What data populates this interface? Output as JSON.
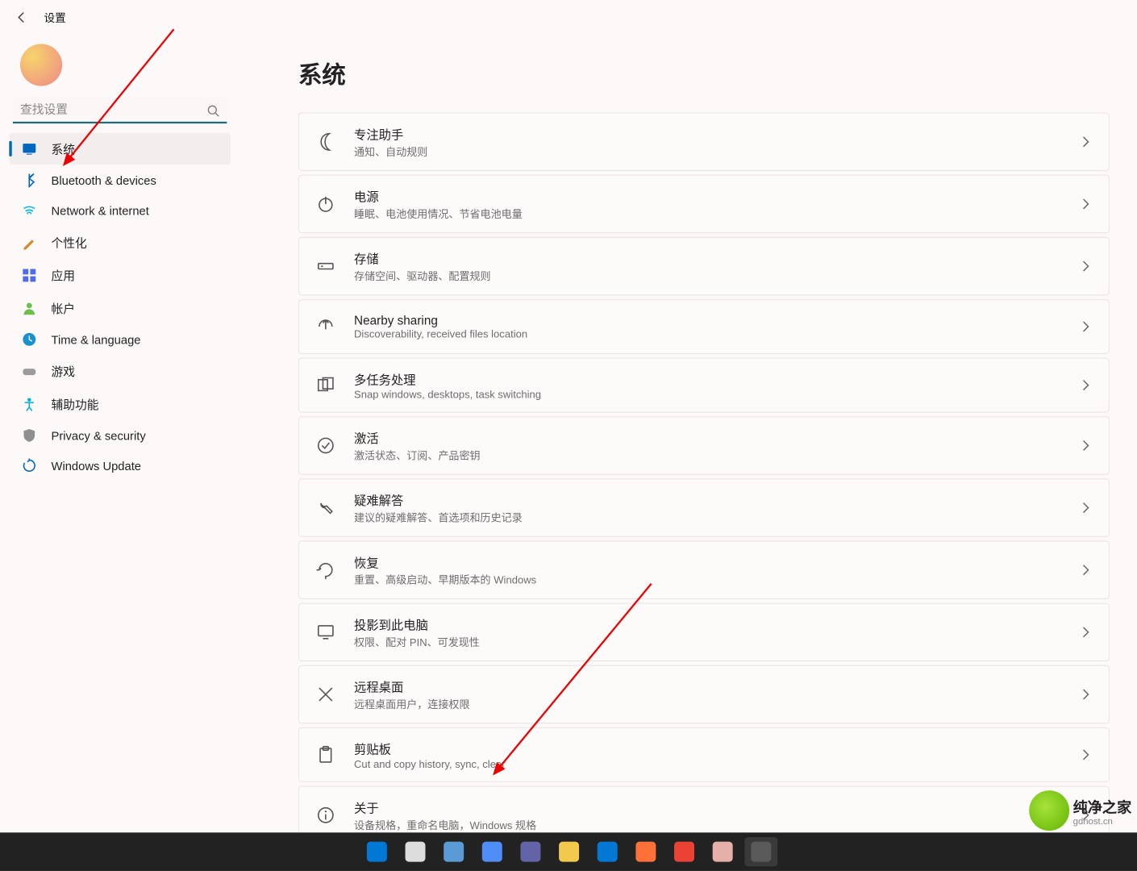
{
  "titlebar": {
    "app_name": "设置"
  },
  "search": {
    "placeholder": "查找设置"
  },
  "sidebar": {
    "items": [
      {
        "label": "系统",
        "icon": "system-icon",
        "color": "#0067c0",
        "active": true
      },
      {
        "label": "Bluetooth & devices",
        "icon": "bluetooth-icon",
        "color": "#0067c0"
      },
      {
        "label": "Network & internet",
        "icon": "wifi-icon",
        "color": "#00b7e0"
      },
      {
        "label": "个性化",
        "icon": "personalize-icon",
        "color": "#d38b2d"
      },
      {
        "label": "应用",
        "icon": "apps-icon",
        "color": "#4f6bed"
      },
      {
        "label": "帐户",
        "icon": "account-icon",
        "color": "#6ebe4a"
      },
      {
        "label": "Time & language",
        "icon": "time-icon",
        "color": "#1a91cf"
      },
      {
        "label": "游戏",
        "icon": "gaming-icon",
        "color": "#9b9b9b"
      },
      {
        "label": "辅助功能",
        "icon": "accessibility-icon",
        "color": "#00aee0"
      },
      {
        "label": "Privacy & security",
        "icon": "privacy-icon",
        "color": "#8f8f8f"
      },
      {
        "label": "Windows Update",
        "icon": "update-icon",
        "color": "#0067c0"
      }
    ]
  },
  "main": {
    "page_title": "系统",
    "cards": [
      {
        "title": "专注助手",
        "desc": "通知、自动规则",
        "icon": "moon-icon"
      },
      {
        "title": "电源",
        "desc": "睡眠、电池使用情况、节省电池电量",
        "icon": "power-icon"
      },
      {
        "title": "存储",
        "desc": "存储空间、驱动器、配置规则",
        "icon": "storage-icon"
      },
      {
        "title": "Nearby sharing",
        "desc": "Discoverability, received files location",
        "icon": "share-icon"
      },
      {
        "title": "多任务处理",
        "desc": "Snap windows, desktops, task switching",
        "icon": "multitask-icon"
      },
      {
        "title": "激活",
        "desc": "激活状态、订阅、产品密钥",
        "icon": "activate-icon"
      },
      {
        "title": "疑难解答",
        "desc": "建议的疑难解答、首选项和历史记录",
        "icon": "troubleshoot-icon"
      },
      {
        "title": "恢复",
        "desc": "重置、高级启动、早期版本的 Windows",
        "icon": "recovery-icon"
      },
      {
        "title": "投影到此电脑",
        "desc": "权限、配对 PIN、可发现性",
        "icon": "project-icon"
      },
      {
        "title": "远程桌面",
        "desc": "远程桌面用户，连接权限",
        "icon": "remote-icon"
      },
      {
        "title": "剪贴板",
        "desc": "Cut and copy history, sync, clear",
        "icon": "clipboard-icon"
      },
      {
        "title": "关于",
        "desc": "设备规格，重命名电脑，Windows 规格",
        "icon": "info-icon"
      }
    ]
  },
  "watermark": {
    "brand": "纯净之家",
    "url": "gdhost.cn"
  },
  "taskbar": {
    "items": [
      "start-icon",
      "search-tb-icon",
      "taskview-icon",
      "widgets-icon",
      "chat-icon",
      "explorer-icon",
      "edge-icon",
      "firefox-icon",
      "chrome-icon",
      "paint-icon",
      "settings-tb-icon"
    ]
  }
}
